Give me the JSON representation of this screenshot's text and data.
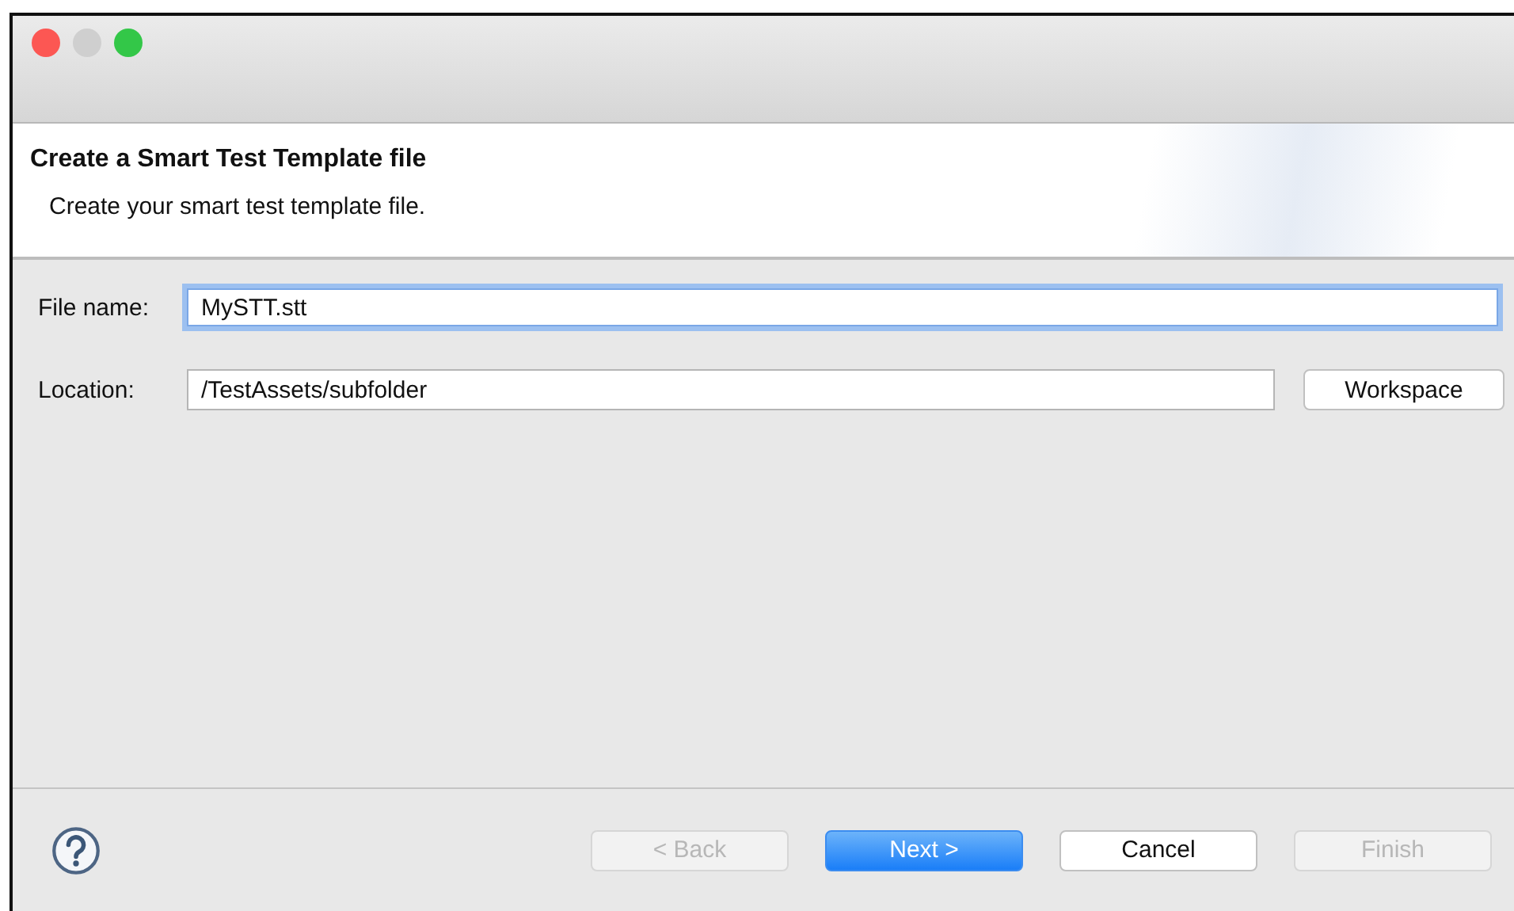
{
  "window": {
    "traffic_lights": [
      {
        "kind": "close",
        "disabled": false
      },
      {
        "kind": "minimize",
        "disabled": true
      },
      {
        "kind": "zoom",
        "disabled": false
      }
    ]
  },
  "header": {
    "title": "Create a Smart Test Template file",
    "description": "Create your smart test template file."
  },
  "fields": [
    {
      "label": "File name:",
      "value": "MySTT.stt",
      "focused": true
    },
    {
      "label": "Location:",
      "value": "/TestAssets/subfolder",
      "focused": false,
      "button": "Workspace"
    }
  ],
  "buttons": [
    {
      "label": "< Back",
      "disabled": true,
      "default": false
    },
    {
      "label": "Next >",
      "disabled": false,
      "default": true
    },
    {
      "label": "Cancel",
      "disabled": false,
      "default": false
    },
    {
      "label": "Finish",
      "disabled": true,
      "default": false
    }
  ]
}
